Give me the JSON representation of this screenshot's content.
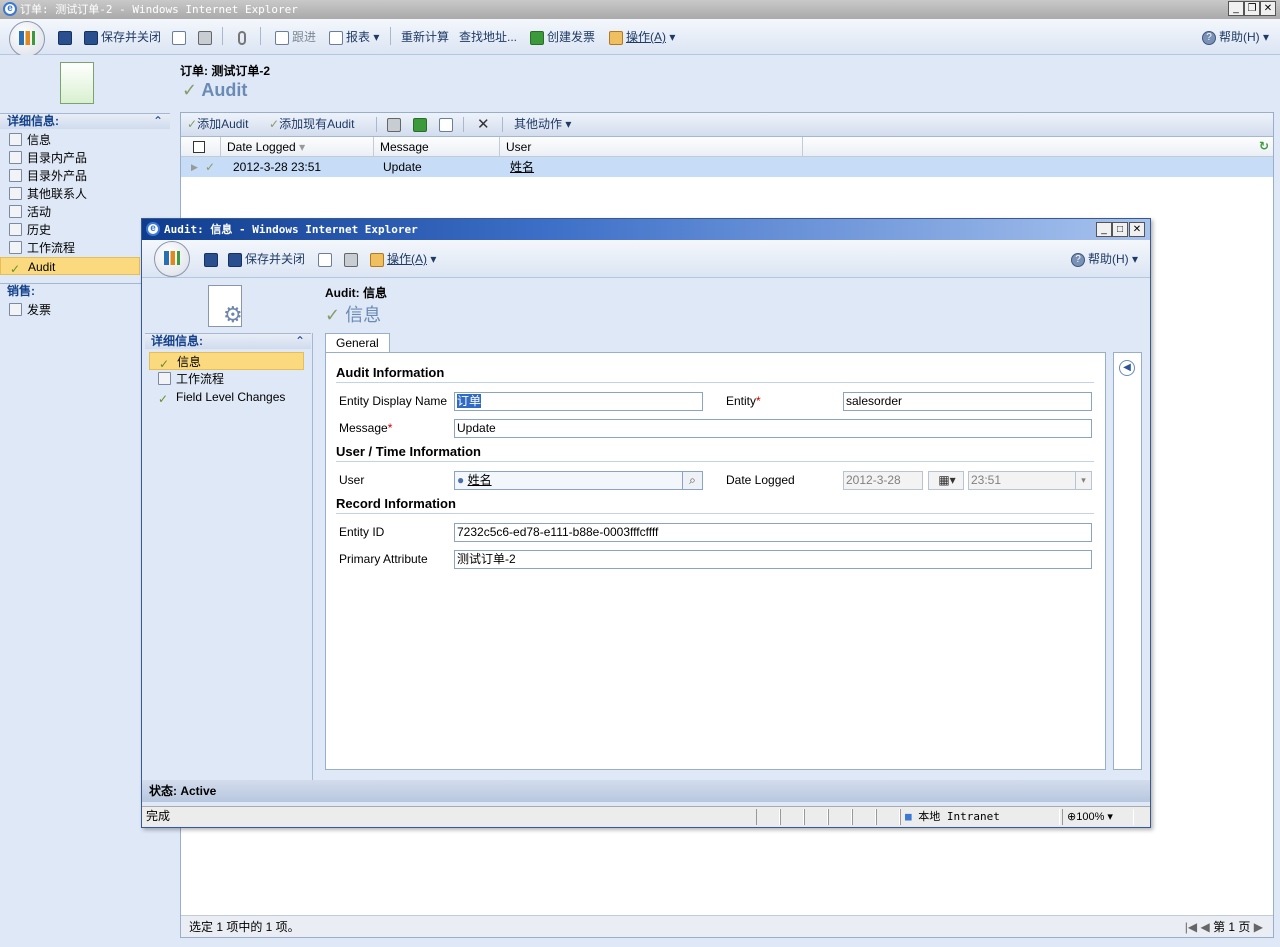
{
  "main_window": {
    "title": "订单: 测试订单-2 - Windows Internet Explorer",
    "toolbar": {
      "save_close": "保存并关闭",
      "followup": "跟进",
      "reports": "报表",
      "recalculate": "重新计算",
      "find_address": "查找地址...",
      "create_invoice": "创建发票",
      "actions": "操作(A)",
      "help": "帮助(H)"
    },
    "header": {
      "entity_line": "订单: 测试订单-2",
      "section_title": "Audit"
    },
    "leftnav": {
      "details_header": "详细信息:",
      "items": [
        "信息",
        "目录内产品",
        "目录外产品",
        "其他联系人",
        "活动",
        "历史",
        "工作流程",
        "Audit"
      ],
      "sales_header": "销售:",
      "sales_items": [
        "发票"
      ]
    },
    "grid": {
      "toolbar": {
        "add_new": "添加Audit",
        "add_existing": "添加现有Audit",
        "more_actions": "其他动作"
      },
      "columns": [
        "Date Logged",
        "Message",
        "User"
      ],
      "rows": [
        {
          "date_logged": "2012-3-28 23:51",
          "message": "Update",
          "user": "姓名"
        }
      ],
      "footer_status": "选定 1 项中的 1 项。",
      "page_label": "第 1 页"
    }
  },
  "popup_window": {
    "title": "Audit: 信息 - Windows Internet Explorer",
    "toolbar": {
      "save_close": "保存并关闭",
      "actions": "操作(A)",
      "help": "帮助(H)"
    },
    "header": {
      "entity_line": "Audit: 信息",
      "section_title": "信息"
    },
    "leftnav": {
      "details_header": "详细信息:",
      "items": [
        "信息",
        "工作流程",
        "Field Level Changes"
      ]
    },
    "tab_label": "General",
    "form": {
      "audit_info_title": "Audit Information",
      "entity_display_name_label": "Entity Display Name",
      "entity_display_name_value": "订单",
      "entity_label": "Entity",
      "entity_value": "salesorder",
      "message_label": "Message",
      "message_value": "Update",
      "user_time_title": "User / Time Information",
      "user_label": "User",
      "user_value": "姓名",
      "date_logged_label": "Date Logged",
      "date_value": "2012-3-28",
      "time_value": "23:51",
      "record_info_title": "Record Information",
      "entity_id_label": "Entity ID",
      "entity_id_value": "7232c5c6-ed78-e111-b88e-0003fffcffff",
      "primary_attribute_label": "Primary Attribute",
      "primary_attribute_value": "测试订单-2",
      "required_marker": "*"
    },
    "status": {
      "label": "状态: Active"
    },
    "ie_status": {
      "text": "完成",
      "zone": "本地 Intranet",
      "zoom": "100%"
    }
  },
  "colors": {
    "nav_selected": "#fad97f",
    "row_selected": "#c7dcf6",
    "header_text": "#15428b",
    "section_title_gray": "#6b8bb5"
  }
}
